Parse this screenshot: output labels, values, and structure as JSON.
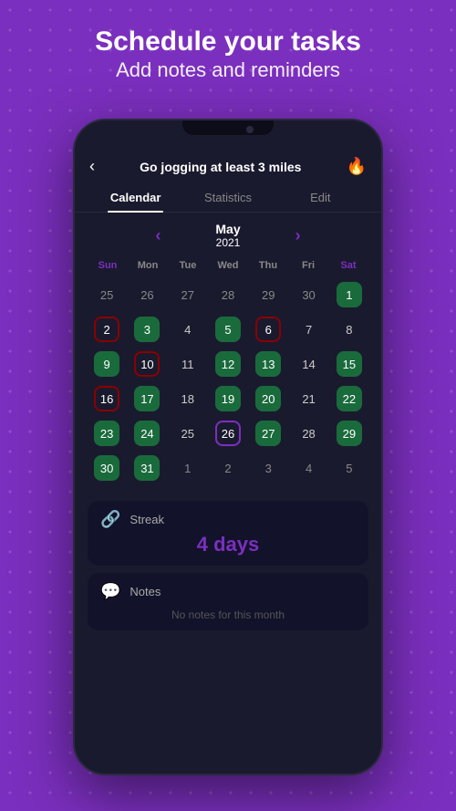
{
  "header": {
    "title_line1": "Schedule your tasks",
    "title_line2": "Add notes and reminders"
  },
  "topbar": {
    "back_label": "‹",
    "title": "Go jogging at least 3 miles",
    "fire_icon": "🔥"
  },
  "tabs": [
    {
      "label": "Calendar",
      "active": true
    },
    {
      "label": "Statistics",
      "active": false
    },
    {
      "label": "Edit",
      "active": false
    }
  ],
  "calendar": {
    "month": "May",
    "year": "2021",
    "prev_arrow": "‹",
    "next_arrow": "›",
    "day_names": [
      "Sun",
      "Mon",
      "Tue",
      "Wed",
      "Thu",
      "Fri",
      "Sat"
    ],
    "weeks": [
      [
        {
          "day": "25",
          "type": "other"
        },
        {
          "day": "26",
          "type": "other"
        },
        {
          "day": "27",
          "type": "other"
        },
        {
          "day": "28",
          "type": "other"
        },
        {
          "day": "29",
          "type": "other"
        },
        {
          "day": "30",
          "type": "other"
        },
        {
          "day": "1",
          "type": "green"
        }
      ],
      [
        {
          "day": "2",
          "type": "red"
        },
        {
          "day": "3",
          "type": "green"
        },
        {
          "day": "4",
          "type": "normal"
        },
        {
          "day": "5",
          "type": "green"
        },
        {
          "day": "6",
          "type": "red"
        },
        {
          "day": "7",
          "type": "normal"
        },
        {
          "day": "8",
          "type": "normal"
        }
      ],
      [
        {
          "day": "9",
          "type": "green"
        },
        {
          "day": "10",
          "type": "red"
        },
        {
          "day": "11",
          "type": "normal"
        },
        {
          "day": "12",
          "type": "green"
        },
        {
          "day": "13",
          "type": "green"
        },
        {
          "day": "14",
          "type": "normal"
        },
        {
          "day": "15",
          "type": "green"
        }
      ],
      [
        {
          "day": "16",
          "type": "red"
        },
        {
          "day": "17",
          "type": "green"
        },
        {
          "day": "18",
          "type": "normal"
        },
        {
          "day": "19",
          "type": "green"
        },
        {
          "day": "20",
          "type": "green"
        },
        {
          "day": "21",
          "type": "normal"
        },
        {
          "day": "22",
          "type": "green"
        }
      ],
      [
        {
          "day": "23",
          "type": "green"
        },
        {
          "day": "24",
          "type": "green"
        },
        {
          "day": "25",
          "type": "normal"
        },
        {
          "day": "26",
          "type": "today"
        },
        {
          "day": "27",
          "type": "green"
        },
        {
          "day": "28",
          "type": "normal"
        },
        {
          "day": "29",
          "type": "green"
        }
      ],
      [
        {
          "day": "30",
          "type": "green"
        },
        {
          "day": "31",
          "type": "green"
        },
        {
          "day": "1",
          "type": "other"
        },
        {
          "day": "2",
          "type": "other"
        },
        {
          "day": "3",
          "type": "other"
        },
        {
          "day": "4",
          "type": "other"
        },
        {
          "day": "5",
          "type": "other"
        }
      ]
    ]
  },
  "streak": {
    "label": "Streak",
    "value": "4 days",
    "icon": "🔗"
  },
  "notes": {
    "label": "Notes",
    "empty_text": "No notes for this month",
    "icon": "💬"
  }
}
